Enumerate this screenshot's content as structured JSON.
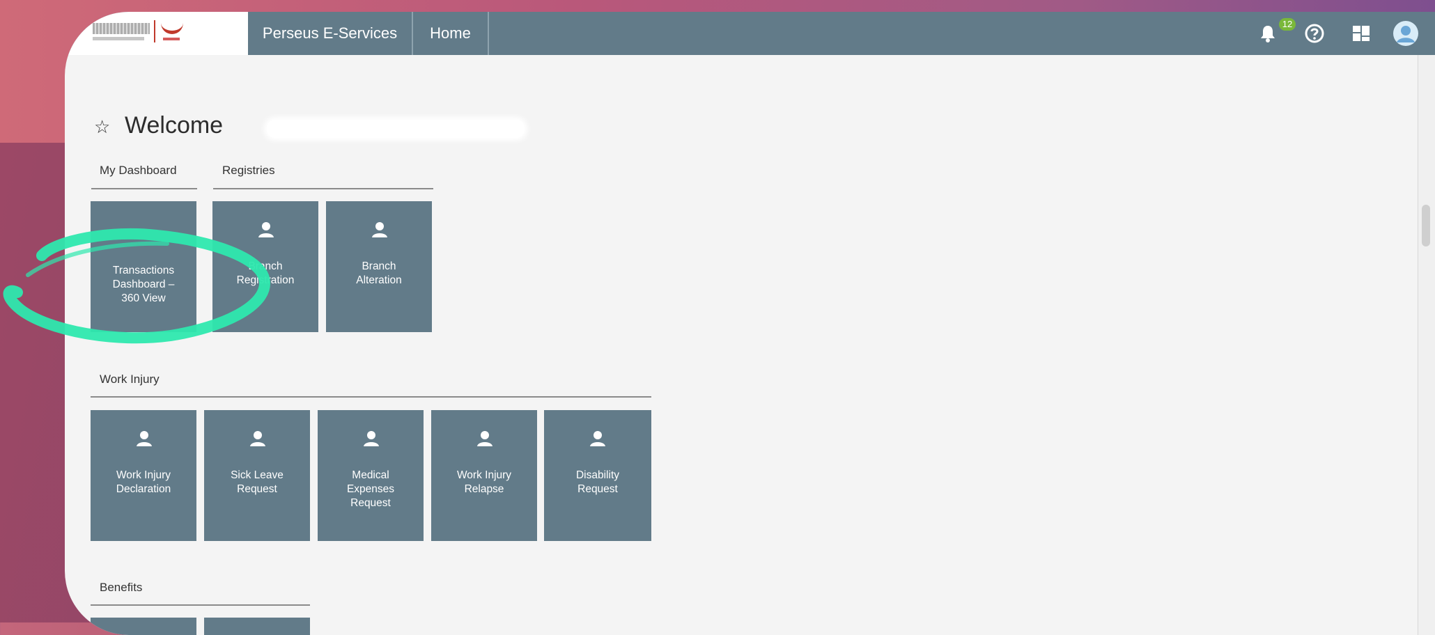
{
  "header": {
    "app_name": "Perseus E-Services",
    "home_label": "Home",
    "notification_count": "12"
  },
  "welcome": {
    "text": "Welcome"
  },
  "sections": {
    "my_dashboard": "My Dashboard",
    "registries": "Registries",
    "work_injury": "Work Injury",
    "benefits": "Benefits"
  },
  "tiles": {
    "transactions": "Transactions\nDashboard –\n360 View",
    "branch_registration": "Branch\nRegistration",
    "branch_alteration": "Branch\nAlteration",
    "work_injury_declaration": "Work Injury\nDeclaration",
    "sick_leave_request": "Sick Leave\nRequest",
    "medical_expenses_request": "Medical\nExpenses\nRequest",
    "work_injury_relapse": "Work Injury\nRelapse",
    "disability_request": "Disability\nRequest"
  },
  "colors": {
    "topbar": "#627b89",
    "tile": "#627b89",
    "annotation": "#2ee8ae",
    "badge": "#7ab83a"
  },
  "icons": [
    "bell-icon",
    "help-icon",
    "dashboard-grid-icon",
    "user-avatar-icon",
    "star-icon",
    "person-icon"
  ]
}
